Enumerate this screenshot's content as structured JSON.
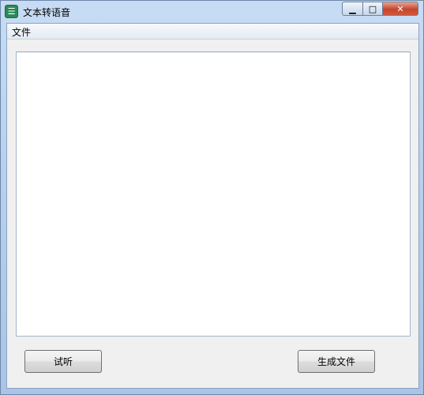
{
  "window": {
    "title": "文本转语音",
    "controls": {
      "minimize": "▁",
      "maximize": "□",
      "close": "✕"
    }
  },
  "menu": {
    "items": [
      {
        "label": "文件"
      }
    ]
  },
  "editor": {
    "value": ""
  },
  "buttons": {
    "listen": "试听",
    "generate": "生成文件"
  },
  "icons": {
    "app": "app-logo-icon"
  },
  "colors": {
    "close_button": "#c6452c",
    "window_frame": "#b9d1ee"
  }
}
